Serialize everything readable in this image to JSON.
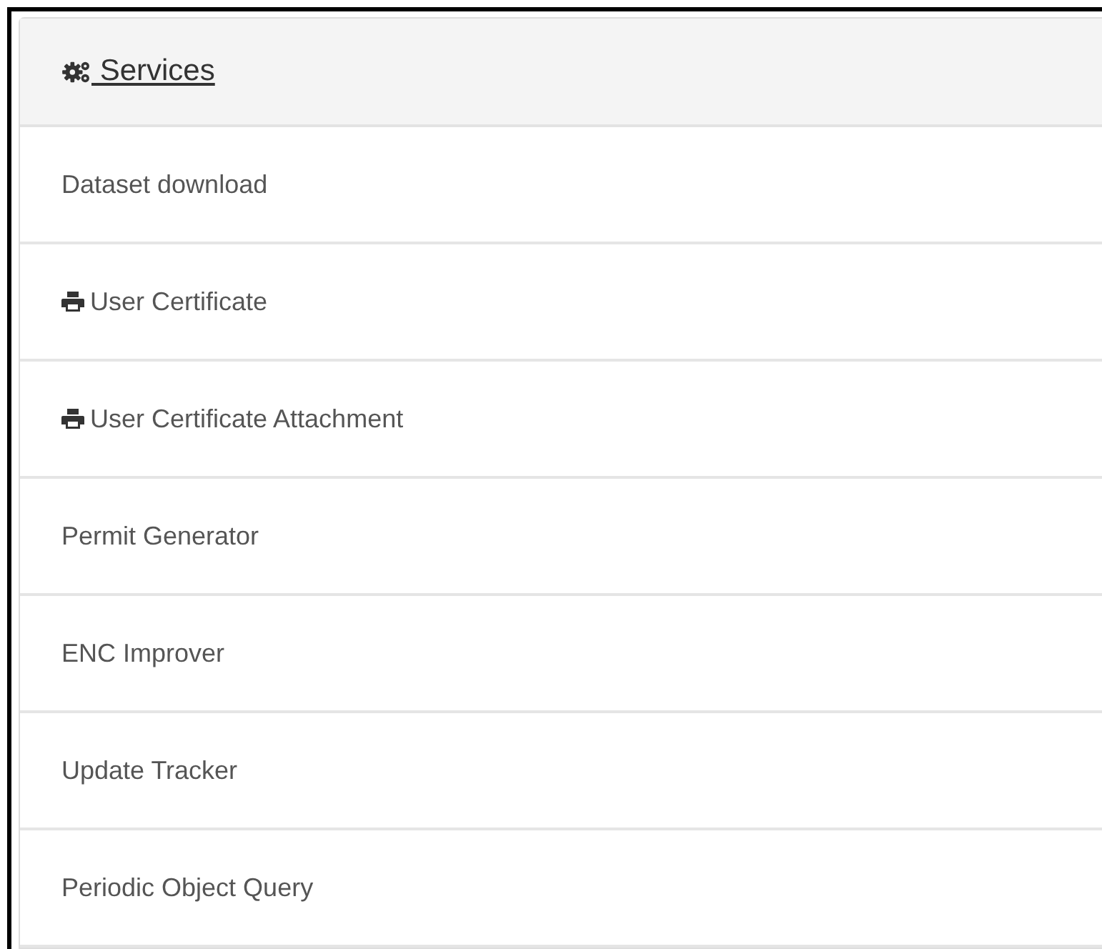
{
  "panel": {
    "title": "Services",
    "items": [
      {
        "label": "Dataset download",
        "kind": "plain"
      },
      {
        "label": "User Certificate",
        "kind": "print"
      },
      {
        "label": "User Certificate Attachment",
        "kind": "print"
      },
      {
        "label": "Permit Generator",
        "kind": "plain"
      },
      {
        "label": "ENC Improver",
        "kind": "plain"
      },
      {
        "label": "Update Tracker",
        "kind": "plain"
      },
      {
        "label": "Periodic Object Query",
        "kind": "plain"
      }
    ]
  }
}
